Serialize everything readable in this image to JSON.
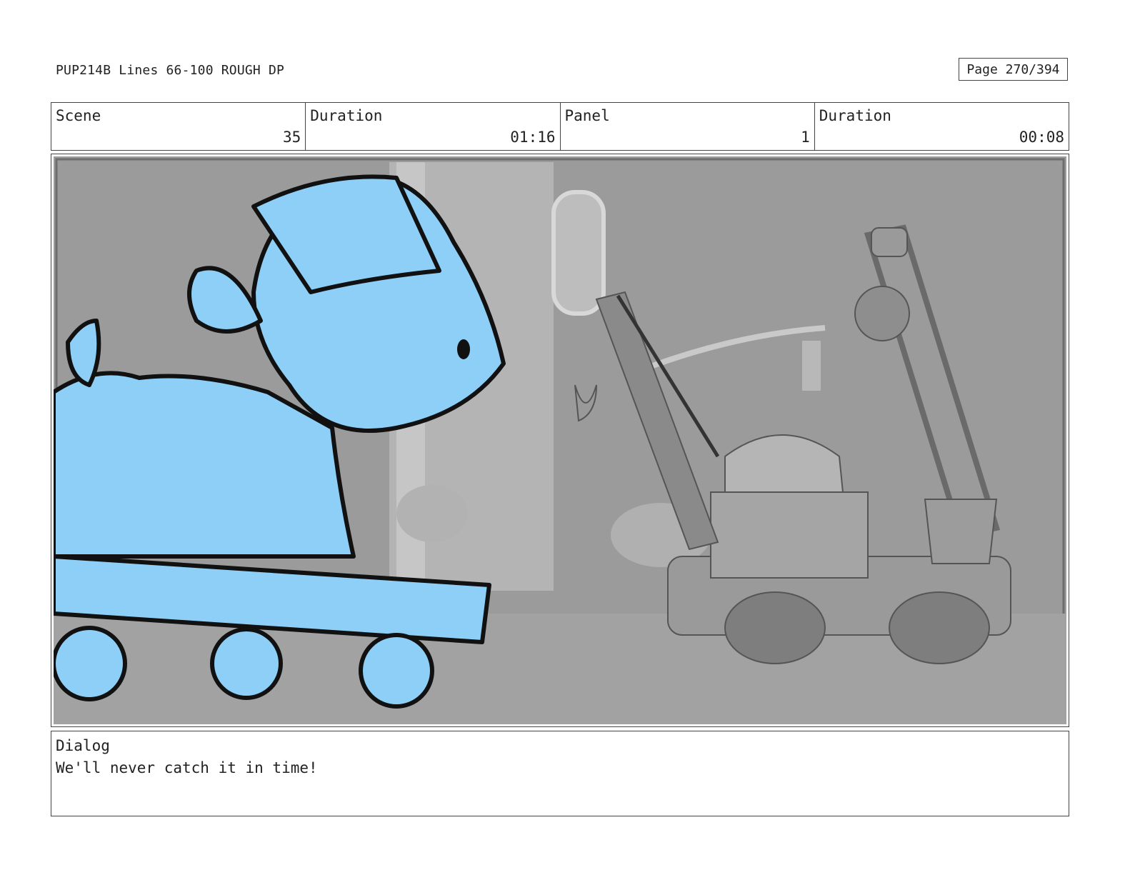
{
  "header": {
    "title": "PUP214B Lines 66-100 ROUGH DP",
    "page": "Page 270/394"
  },
  "info": {
    "scene_label": "Scene",
    "scene_value": "35",
    "scene_duration_label": "Duration",
    "scene_duration_value": "01:16",
    "panel_label": "Panel",
    "panel_value": "1",
    "panel_duration_label": "Duration",
    "panel_duration_value": "00:08"
  },
  "panel_image": {
    "description_icon": "storyboard-frame",
    "character_color": "#8ecff7",
    "background_color": "#9a9a9a"
  },
  "dialog": {
    "label": "Dialog",
    "text": "We'll never catch it in time!"
  }
}
